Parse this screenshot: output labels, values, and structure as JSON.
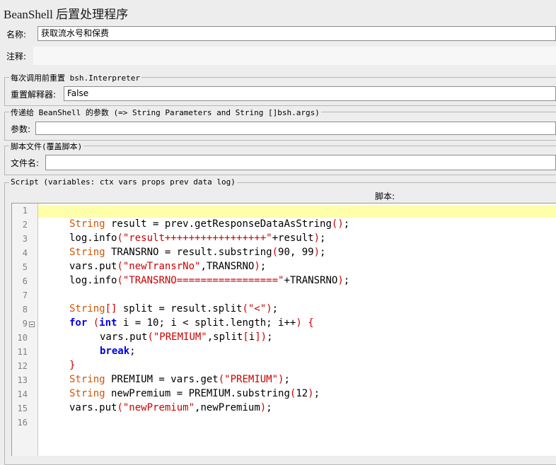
{
  "title": "BeanShell 后置处理程序",
  "name_label": "名称:",
  "name_value": "获取流水号和保费",
  "comment_label": "注释:",
  "comment_value": "",
  "reset_group": {
    "legend": "每次调用前重置 bsh.Interpreter",
    "label": "重置解释器:",
    "value": "False"
  },
  "params_group": {
    "legend": "传递给 BeanShell 的参数 (=> String Parameters and String []bsh.args)",
    "label": "参数:",
    "value": ""
  },
  "file_group": {
    "legend": "脚本文件(覆盖脚本)",
    "label": "文件名:",
    "value": ""
  },
  "script_group": {
    "legend": "Script (variables: ctx vars props prev data log)",
    "header": "脚本:"
  },
  "code_lines": [
    {
      "n": "1",
      "text": ""
    },
    {
      "n": "2",
      "text": "String result = prev.getResponseDataAsString();"
    },
    {
      "n": "3",
      "text": "log.info(\"result+++++++++++++++++\"+result);"
    },
    {
      "n": "4",
      "text": "String TRANSRNO = result.substring(90, 99);"
    },
    {
      "n": "5",
      "text": "vars.put(\"newTransrNo\",TRANSRNO);"
    },
    {
      "n": "6",
      "text": "log.info(\"TRANSRNO=================\"+TRANSRNO);"
    },
    {
      "n": "7",
      "text": ""
    },
    {
      "n": "8",
      "text": "String[] split = result.split(\"<\");"
    },
    {
      "n": "9",
      "text": "for (int i = 10; i < split.length; i++) {"
    },
    {
      "n": "10",
      "text": "vars.put(\"PREMIUM\",split[i]);"
    },
    {
      "n": "11",
      "text": "break;"
    },
    {
      "n": "12",
      "text": "}"
    },
    {
      "n": "13",
      "text": "String PREMIUM = vars.get(\"PREMIUM\");"
    },
    {
      "n": "14",
      "text": "String newPremium = PREMIUM.substring(12);"
    },
    {
      "n": "15",
      "text": "vars.put(\"newPremium\",newPremium);"
    },
    {
      "n": "16",
      "text": ""
    }
  ],
  "colors": {
    "keyword": "#0000e6",
    "type": "#d35400",
    "string": "#cc0000",
    "current_line": "#ffffaa"
  }
}
